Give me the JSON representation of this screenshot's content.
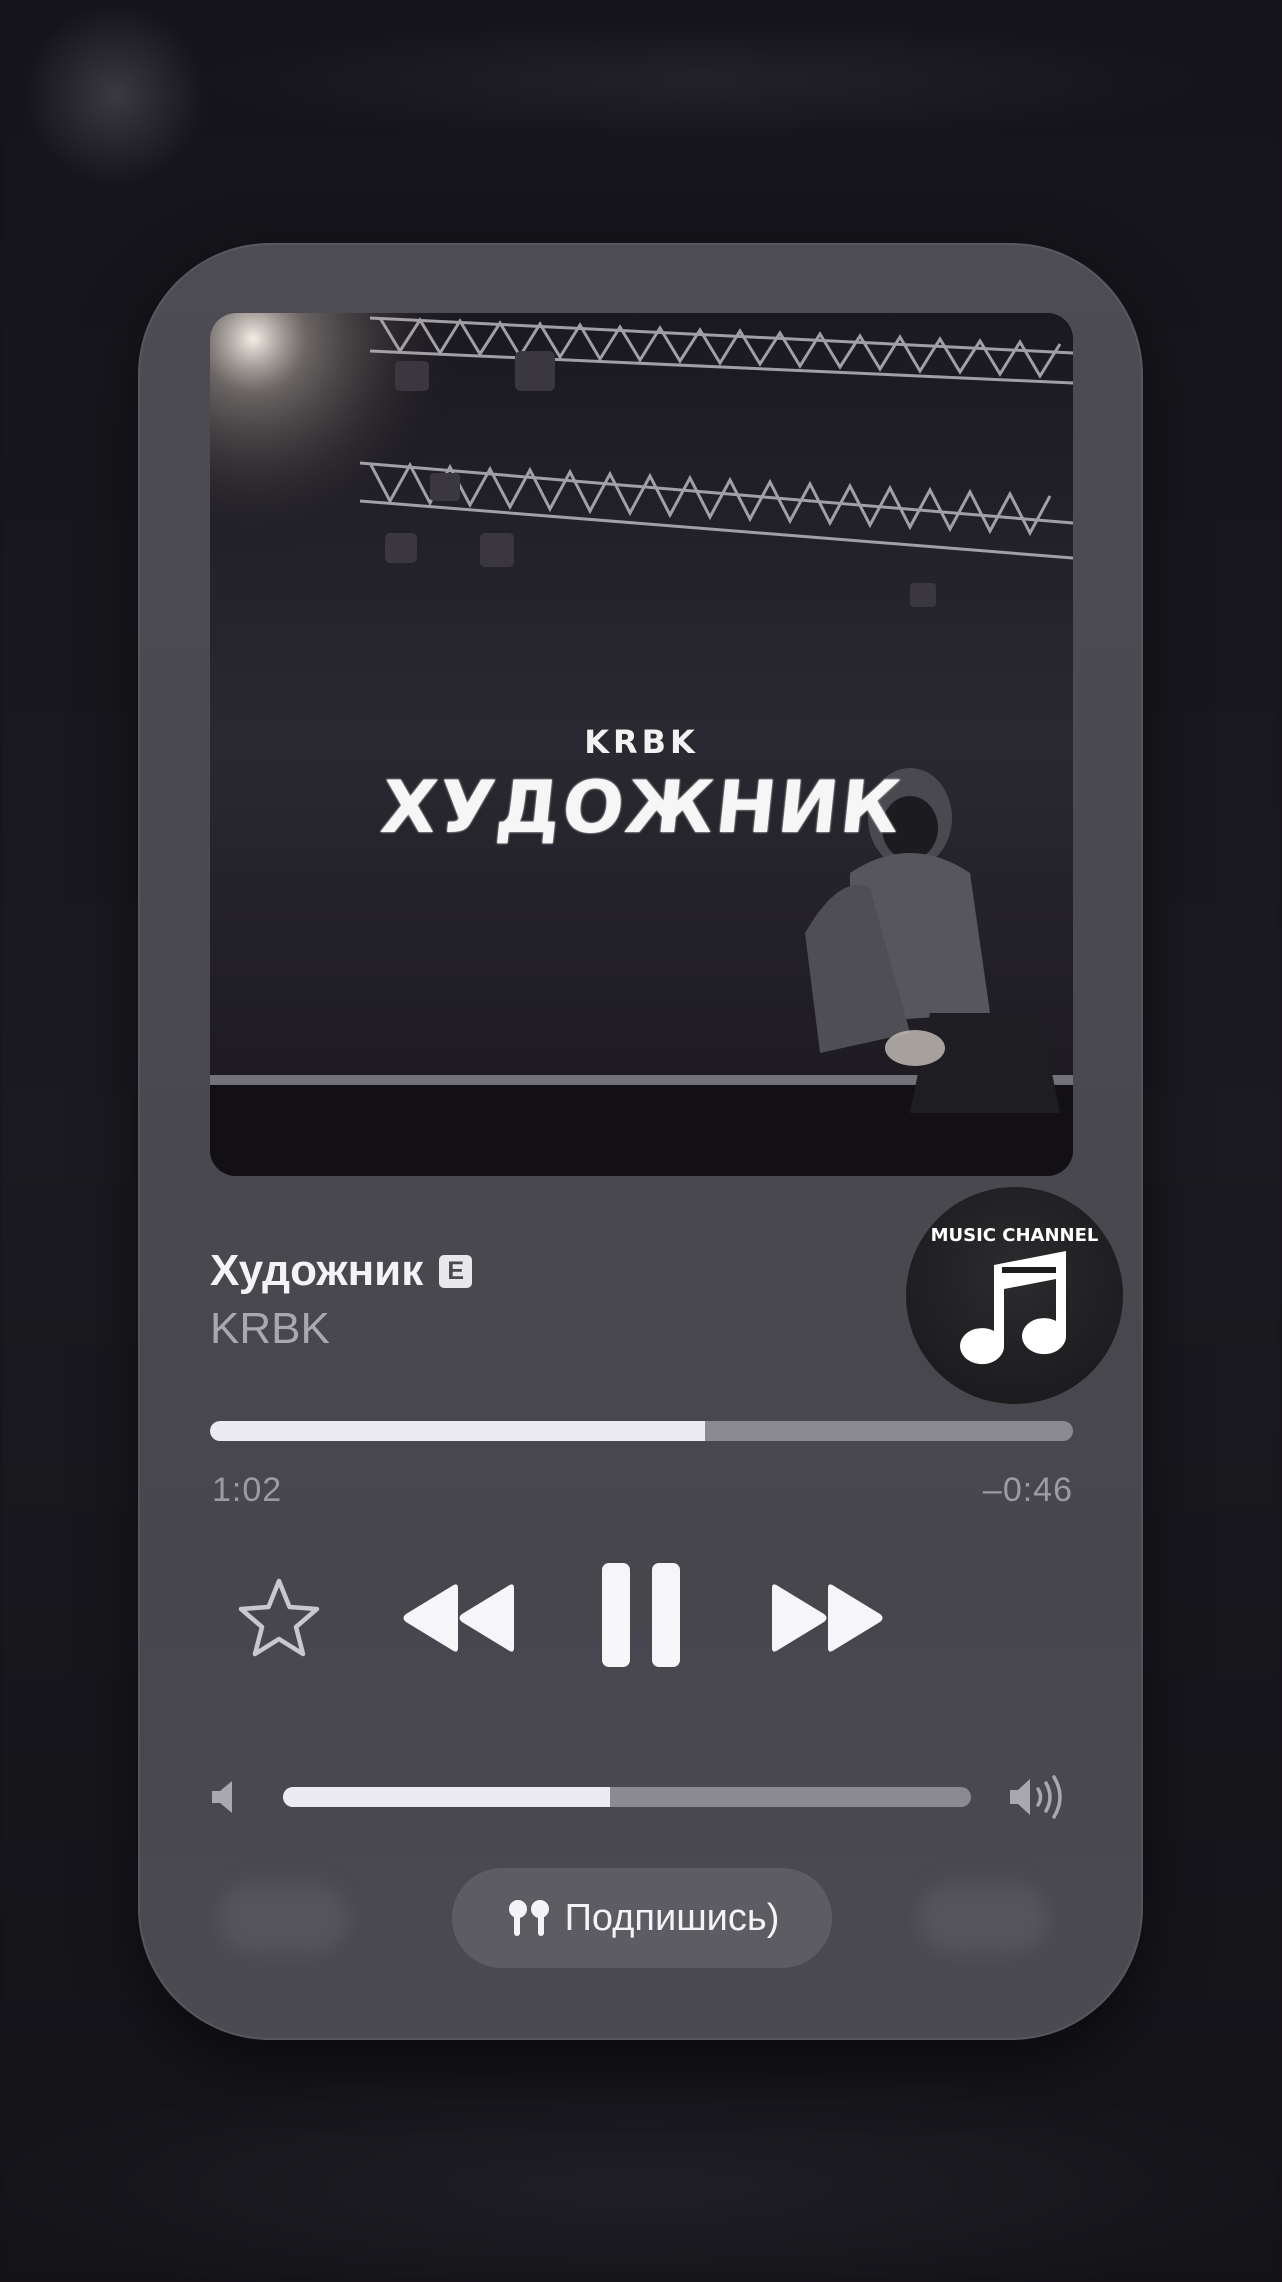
{
  "now_playing": {
    "artwork": {
      "artist_text": "KRBK",
      "title_text": "ХУДОЖНИК"
    },
    "track_title": "Художник",
    "explicit_badge": "E",
    "artist": "KRBK",
    "progress": {
      "elapsed": "1:02",
      "remaining": "–0:46",
      "fraction": 0.574
    },
    "volume": {
      "fraction": 0.476
    },
    "controls": {
      "favorite_icon": "star-icon",
      "previous_icon": "rewind-icon",
      "play_pause_icon": "pause-icon",
      "next_icon": "fast-forward-icon"
    },
    "output_device": {
      "icon": "airpods-icon",
      "label": "Подпишись)"
    },
    "channel_badge": {
      "text": "MUSIC CHANNEL",
      "icon": "music-note-icon"
    }
  },
  "colors": {
    "card_background": "#4b4a51",
    "slider_fill": "#ecebf1",
    "slider_track": "#8b8a91",
    "secondary_text": "#a9a8ae"
  }
}
